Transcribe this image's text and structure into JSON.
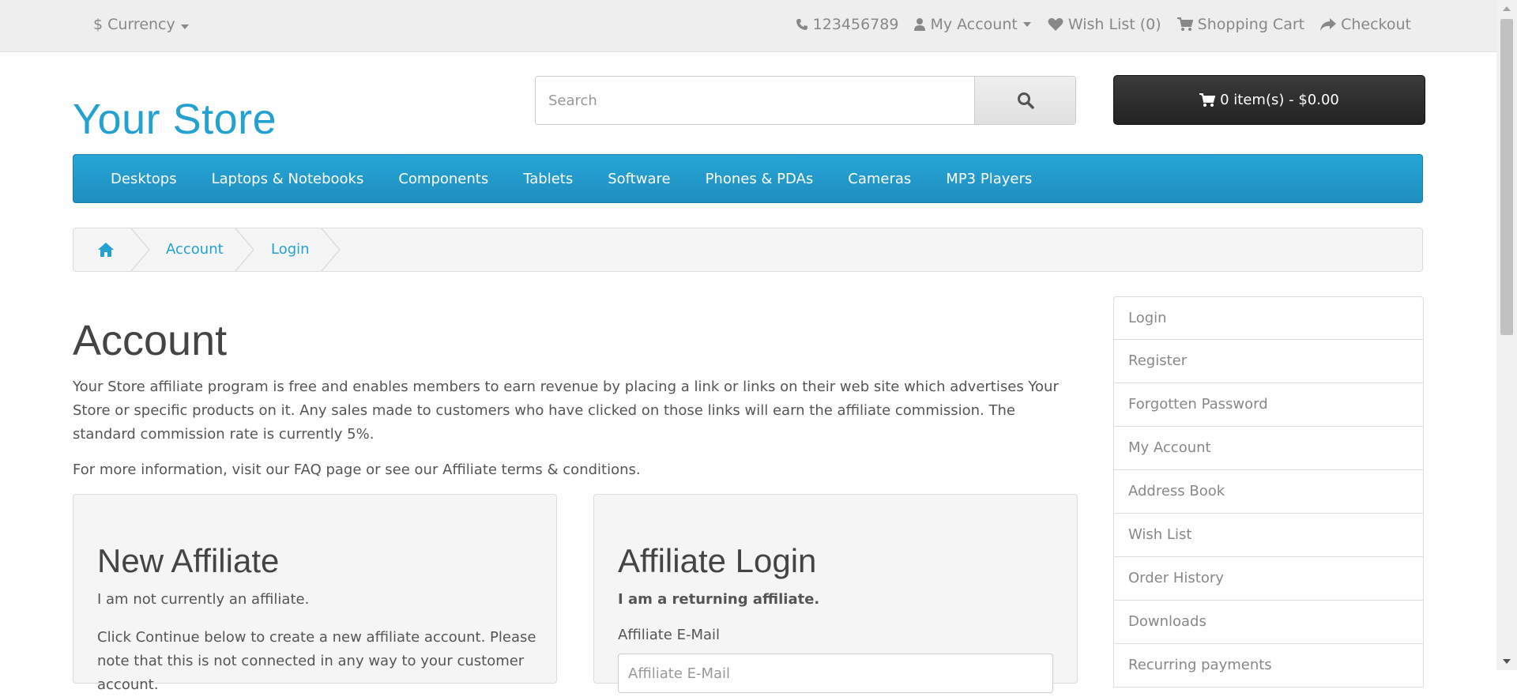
{
  "topbar": {
    "currency_label": "Currency",
    "phone": "123456789",
    "my_account": "My Account",
    "wishlist": "Wish List (0)",
    "shopping_cart": "Shopping Cart",
    "checkout": "Checkout"
  },
  "header": {
    "logo": "Your Store",
    "search_placeholder": "Search",
    "cart_label": "0 item(s) - $0.00"
  },
  "menu": [
    "Desktops",
    "Laptops & Notebooks",
    "Components",
    "Tablets",
    "Software",
    "Phones & PDAs",
    "Cameras",
    "MP3 Players"
  ],
  "breadcrumb": [
    "Account",
    "Login"
  ],
  "main": {
    "title": "Account",
    "intro": "Your Store affiliate program is free and enables members to earn revenue by placing a link or links on their web site which advertises Your Store or specific products on it. Any sales made to customers who have clicked on those links will earn the affiliate commission. The standard commission rate is currently 5%.",
    "more_info": "For more information, visit our FAQ page or see our Affiliate terms & conditions."
  },
  "new_affiliate": {
    "heading": "New Affiliate",
    "line1": "I am not currently an affiliate.",
    "line2": "Click Continue below to create a new affiliate account. Please note that this is not connected in any way to your customer account."
  },
  "affiliate_login": {
    "heading": "Affiliate Login",
    "line1": "I am a returning affiliate.",
    "email_label": "Affiliate E-Mail",
    "email_placeholder": "Affiliate E-Mail"
  },
  "sidebar": [
    "Login",
    "Register",
    "Forgotten Password",
    "My Account",
    "Address Book",
    "Wish List",
    "Order History",
    "Downloads",
    "Recurring payments"
  ],
  "colors": {
    "accent": "#23a1d1",
    "menu": "#229ac8",
    "cart": "#2b2b2b"
  }
}
